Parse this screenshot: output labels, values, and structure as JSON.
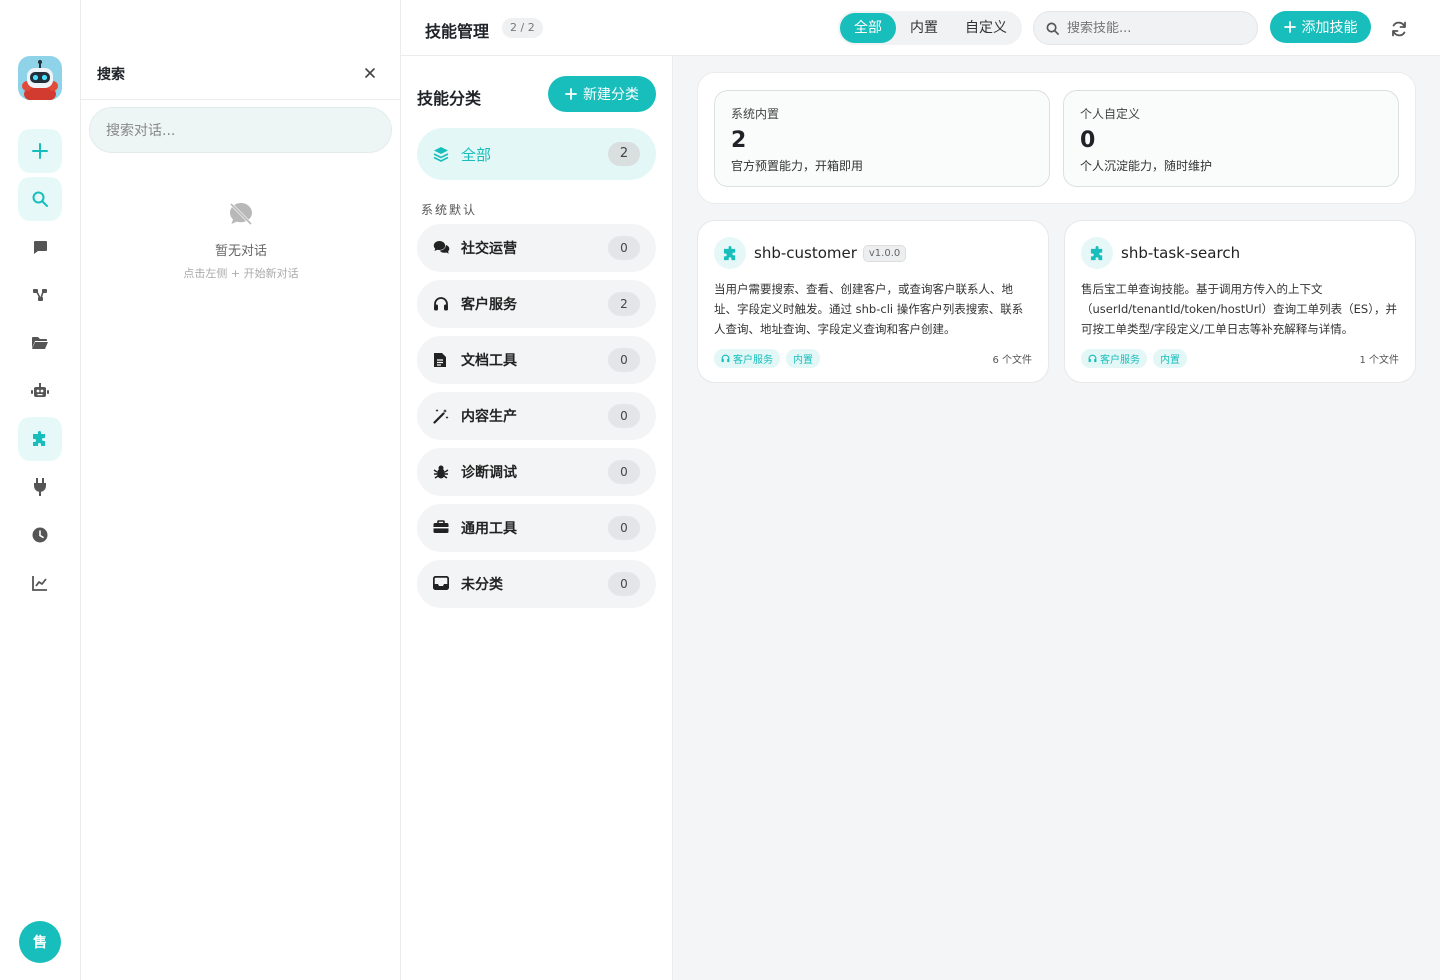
{
  "rail": {
    "items": [
      "new",
      "search",
      "chat",
      "flow",
      "folder",
      "robot",
      "skills",
      "plugin",
      "history",
      "analytics"
    ],
    "avatar": "售"
  },
  "search_panel": {
    "title": "搜索",
    "placeholder": "搜索对话...",
    "empty_title": "暂无对话",
    "empty_subtitle": "点击左侧 + 开始新对话"
  },
  "header": {
    "title": "技能管理",
    "count": "2 / 2",
    "filters": [
      "全部",
      "内置",
      "自定义"
    ],
    "active_filter": "全部",
    "search_placeholder": "搜索技能...",
    "add_label": "添加技能"
  },
  "categories": {
    "title": "技能分类",
    "new_label": "新建分类",
    "all": {
      "label": "全部",
      "count": "2",
      "icon": "layers-icon"
    },
    "section_label": "系统默认",
    "items": [
      {
        "label": "社交运营",
        "count": "0",
        "icon": "comments-icon"
      },
      {
        "label": "客户服务",
        "count": "2",
        "icon": "headset-icon"
      },
      {
        "label": "文档工具",
        "count": "0",
        "icon": "file-icon"
      },
      {
        "label": "内容生产",
        "count": "0",
        "icon": "magic-wand-icon"
      },
      {
        "label": "诊断调试",
        "count": "0",
        "icon": "bug-icon"
      },
      {
        "label": "通用工具",
        "count": "0",
        "icon": "toolbox-icon"
      },
      {
        "label": "未分类",
        "count": "0",
        "icon": "inbox-icon"
      }
    ]
  },
  "stats": [
    {
      "label": "系统内置",
      "value": "2",
      "desc": "官方预置能力，开箱即用"
    },
    {
      "label": "个人自定义",
      "value": "0",
      "desc": "个人沉淀能力，随时维护"
    }
  ],
  "skills": [
    {
      "name": "shb-customer",
      "version": "v1.0.0",
      "desc": "当用户需要搜索、查看、创建客户，或查询客户联系人、地址、字段定义时触发。通过 shb-cli 操作客户列表搜索、联系人查询、地址查询、字段定义查询和客户创建。",
      "tags": [
        "客户服务",
        "内置"
      ],
      "files": "6 个文件"
    },
    {
      "name": "shb-task-search",
      "version": "",
      "desc": "售后宝工单查询技能。基于调用方传入的上下文（userId/tenantId/token/hostUrl）查询工单列表（ES），并可按工单类型/字段定义/工单日志等补充解释与详情。",
      "tags": [
        "客户服务",
        "内置"
      ],
      "files": "1 个文件"
    }
  ],
  "colors": {
    "accent": "#17bebb"
  }
}
